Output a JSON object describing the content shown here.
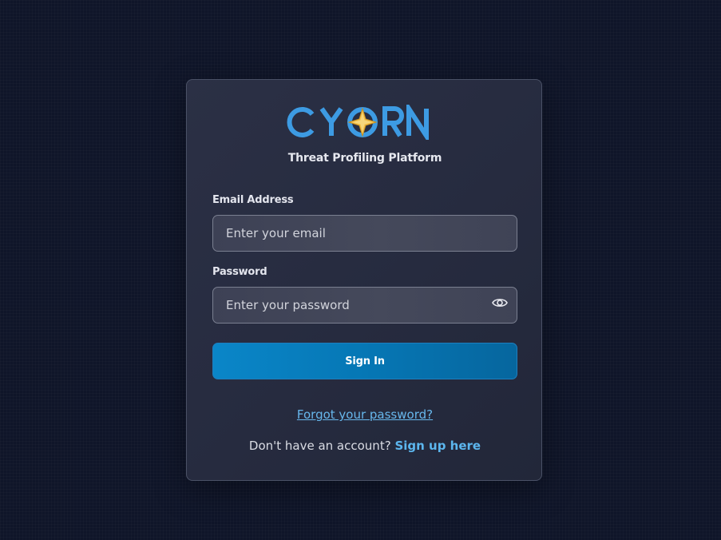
{
  "brand": {
    "logo_text": "CYORN",
    "subtitle": "Threat Profiling Platform",
    "logo_color": "#3d9be3",
    "star_color": "#f2c14e"
  },
  "form": {
    "email": {
      "label": "Email Address",
      "placeholder": "Enter your email",
      "value": ""
    },
    "password": {
      "label": "Password",
      "placeholder": "Enter your password",
      "value": "",
      "toggle_icon": "eye-icon"
    },
    "submit_label": "Sign In"
  },
  "links": {
    "forgot": "Forgot your password?",
    "signup_prompt": "Don't have an account?",
    "signup_link": "Sign up here"
  },
  "colors": {
    "background": "#0f1529",
    "card": "#2a2f44",
    "accent": "#0a86c8",
    "link": "#67b7ec"
  }
}
